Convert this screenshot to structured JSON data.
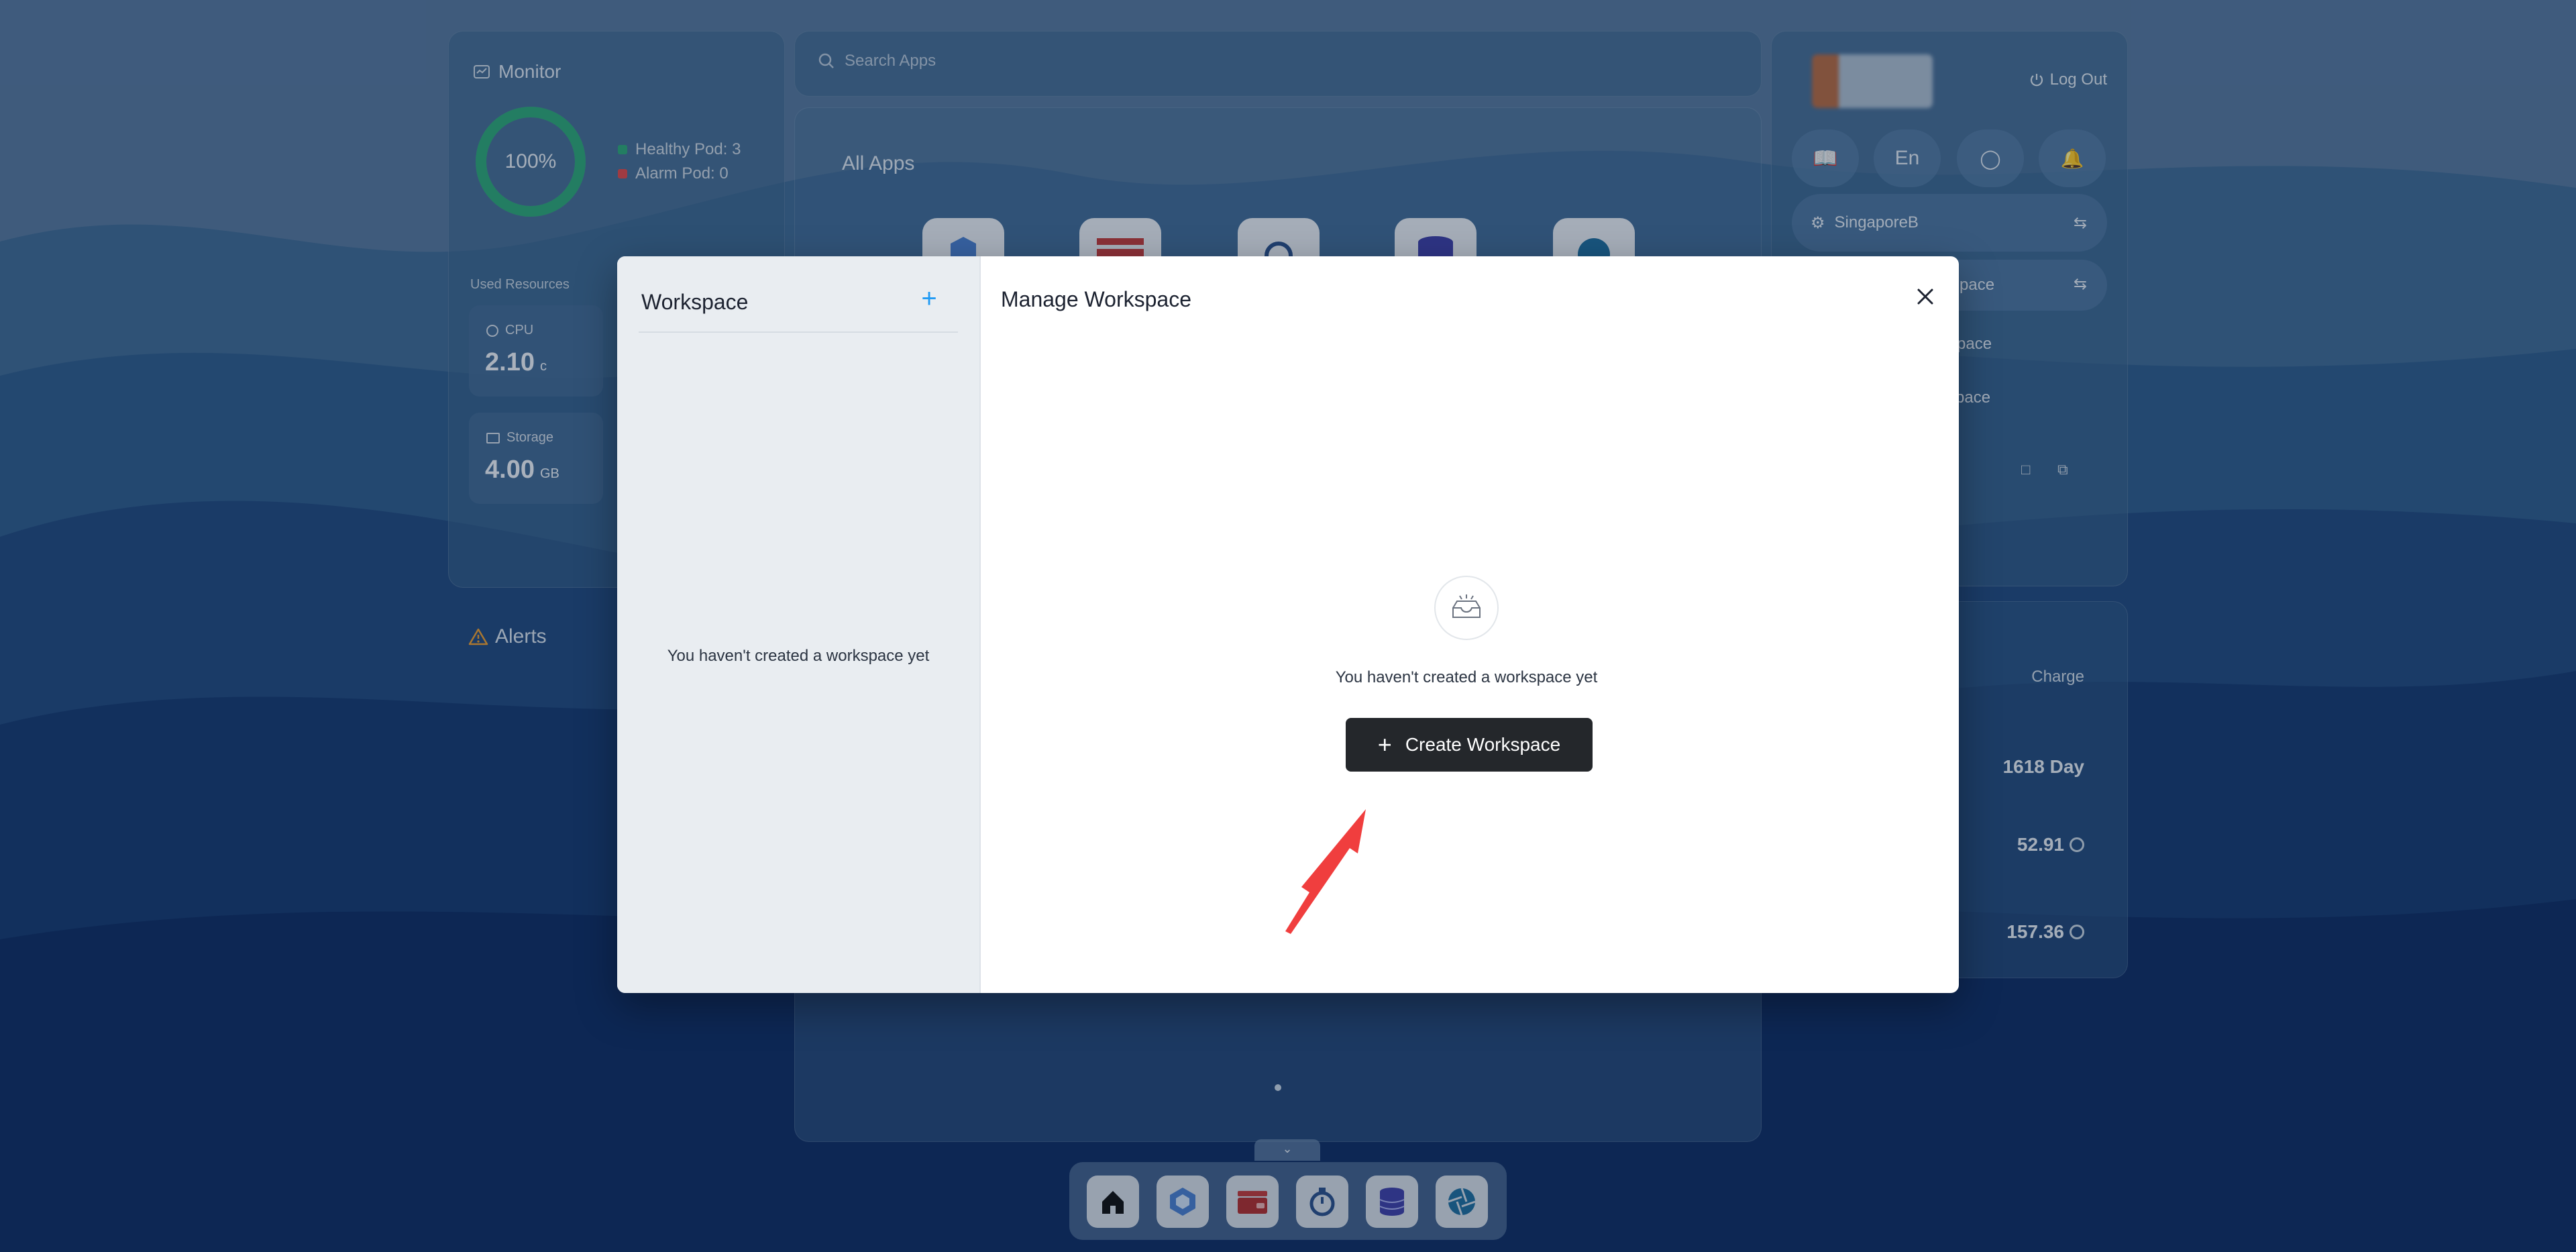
{
  "monitor": {
    "title": "Monitor",
    "health_percent": "100%",
    "health_fraction": 1.0,
    "healthy_pod": "Healthy Pod: 3",
    "alarm_pod": "Alarm Pod: 0",
    "used_resources": "Used Resources",
    "cpu_label": "CPU",
    "cpu_value": "2.10",
    "cpu_unit": "c",
    "storage_label": "Storage",
    "storage_value": "4.00",
    "storage_unit": "GB"
  },
  "alerts": {
    "title": "Alerts"
  },
  "search": {
    "placeholder": "Search Apps"
  },
  "apps": {
    "title": "All Apps"
  },
  "account": {
    "logout": "Log Out",
    "lang": "En",
    "region": "SingaporeB",
    "ws_current": "pace",
    "ws_item1": "pace",
    "ws_item2": "space"
  },
  "cost": {
    "charge": "Charge",
    "days": "1618 Day",
    "balance": "52.91",
    "total": "157.36"
  },
  "modal": {
    "sidebar_title": "Workspace",
    "sidebar_add": "+",
    "sidebar_empty": "You haven't created a workspace yet",
    "main_title": "Manage Workspace",
    "empty_text": "You haven't created a workspace yet",
    "create_label": "Create Workspace",
    "create_plus": "+"
  },
  "colors": {
    "accent": "#219bf4",
    "primary_button": "#24272b",
    "healthy": "#2fa877",
    "alarm": "#e04a4a",
    "arrow": "#f03e3e"
  }
}
